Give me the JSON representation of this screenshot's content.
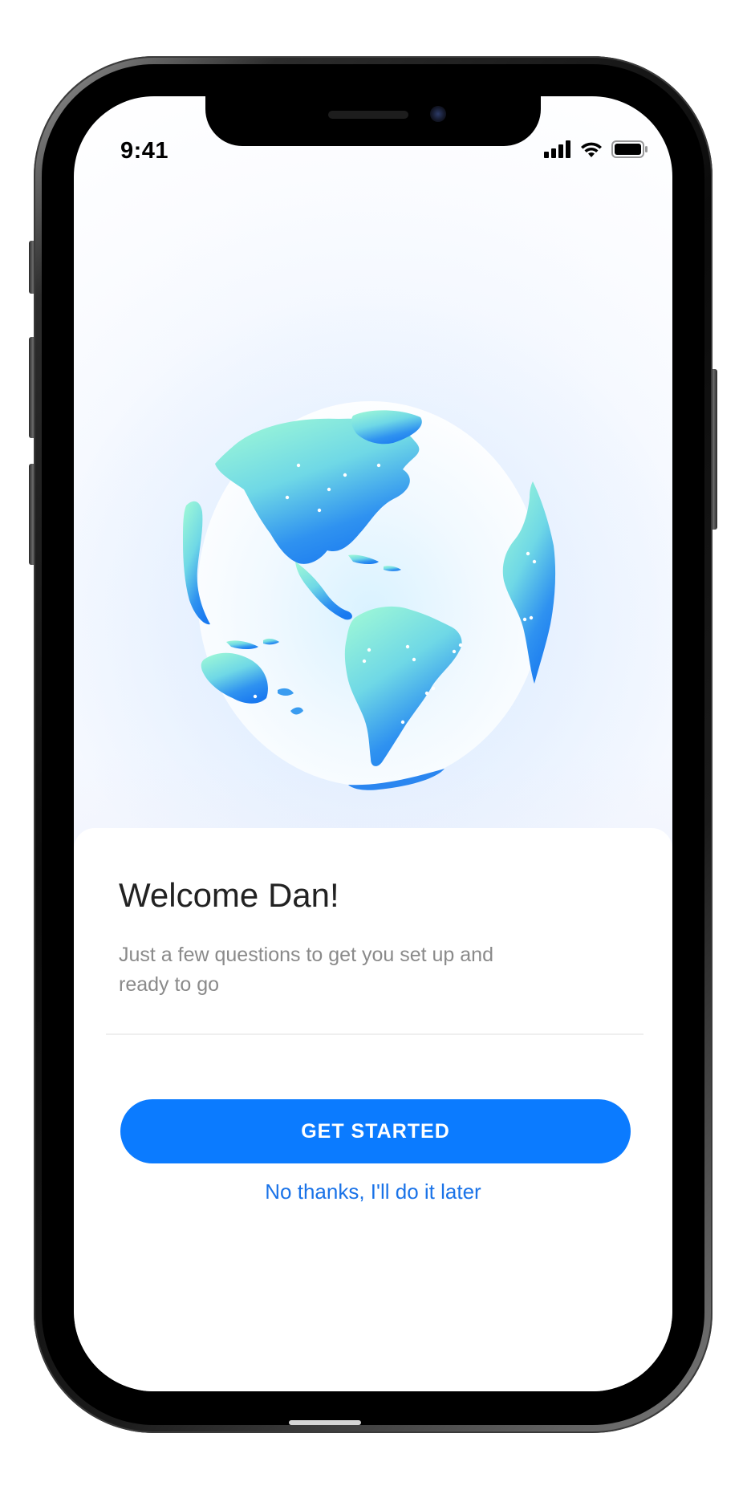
{
  "status_bar": {
    "time": "9:41",
    "icons": [
      "cellular-signal-icon",
      "wifi-icon",
      "battery-icon"
    ]
  },
  "hero": {
    "illustration": "globe-americas-illustration",
    "colors": {
      "land_top": "#8ff0d0",
      "land_bottom": "#1f7df0",
      "city_dots": "#ffffff"
    }
  },
  "welcome": {
    "title": "Welcome Dan!",
    "subtitle": "Just a few questions to get you set up and ready to go"
  },
  "actions": {
    "primary_label": "GET STARTED",
    "secondary_label": "No thanks, I'll do it later"
  },
  "colors": {
    "accent": "#0b7bff",
    "link": "#1a73e8",
    "title_text": "#222222",
    "subtitle_text": "#8a8a8a"
  }
}
